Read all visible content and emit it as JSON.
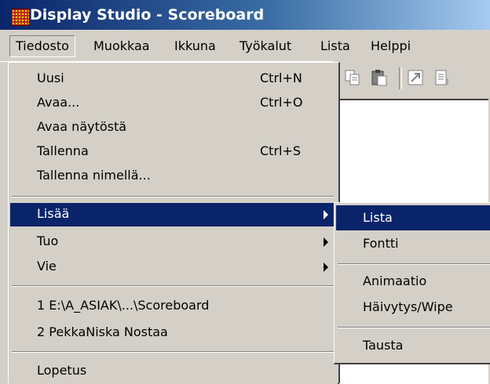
{
  "window": {
    "title": "Display Studio - Scoreboard"
  },
  "menubar": [
    "Tiedosto",
    "Muokkaa",
    "Ikkuna",
    "Työkalut",
    "Lista",
    "Helppi"
  ],
  "file_menu": {
    "new": {
      "label": "Uusi",
      "shortcut": "Ctrl+N"
    },
    "open": {
      "label": "Avaa...",
      "shortcut": "Ctrl+O"
    },
    "open_show": {
      "label": "Avaa näytöstä"
    },
    "save": {
      "label": "Tallenna",
      "shortcut": "Ctrl+S"
    },
    "save_as": {
      "label": "Tallenna nimellä..."
    },
    "insert": {
      "label": "Lisää"
    },
    "import": {
      "label": "Tuo"
    },
    "export": {
      "label": "Vie"
    },
    "recent": [
      "1 E:\\A_ASIAK\\...\\Scoreboard",
      "2 PekkaNiska Nostaa"
    ],
    "exit": {
      "label": "Lopetus"
    }
  },
  "insert_submenu": [
    "Lista",
    "Fontti",
    "Animaatio",
    "Häivytys/Wipe",
    "Tausta"
  ],
  "colors": {
    "highlight": "#0a246a",
    "menu_bg": "#d4d0c8"
  },
  "toolbar_icons": [
    "copy-icon",
    "paste-icon",
    "image-tool-icon",
    "document-icon"
  ]
}
